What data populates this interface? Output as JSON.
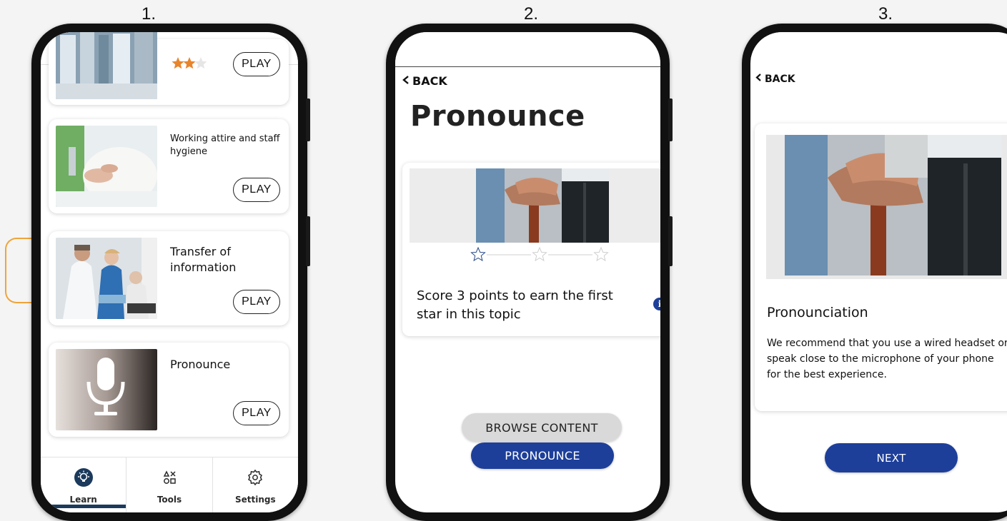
{
  "steps": [
    "1.",
    "2.",
    "3."
  ],
  "phone1": {
    "cards": [
      {
        "title": "",
        "play": "PLAY",
        "stars_filled": 2,
        "stars_total": 3
      },
      {
        "title": "Working attire and staff hygiene",
        "play": "PLAY"
      },
      {
        "title": "Transfer of information",
        "play": "PLAY"
      },
      {
        "title": "Pronounce",
        "play": "PLAY"
      }
    ],
    "tabs": [
      {
        "label": "Learn",
        "icon": "lightbulb-icon",
        "active": true
      },
      {
        "label": "Tools",
        "icon": "tools-icon",
        "active": false
      },
      {
        "label": "Settings",
        "icon": "gear-icon",
        "active": false
      }
    ]
  },
  "phone2": {
    "back": "BACK",
    "title": "Pronounce",
    "score_text": "Score 3 points to earn the first star in this topic",
    "stars_filled": 0,
    "stars_total": 3,
    "browse_label": "BROWSE CONTENT",
    "pronounce_label": "PRONOUNCE"
  },
  "phone3": {
    "back": "BACK",
    "heading": "Pronounciation",
    "body": "We recommend that you use a wired headset or speak close to the microphone of your phone for the best experience.",
    "next_label": "NEXT"
  },
  "colors": {
    "primary_blue": "#1d3f9a",
    "star_orange": "#e8852b",
    "highlight_orange": "#f0a43a",
    "tab_active": "#1b3a5c"
  }
}
